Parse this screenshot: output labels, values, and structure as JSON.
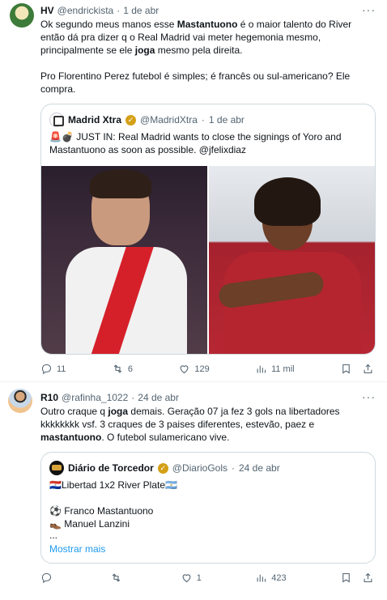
{
  "tweet1": {
    "name": "HV",
    "handle": "@endrickista",
    "date": "1 de abr",
    "text_p1_a": "Ok segundo meus manos esse ",
    "text_p1_b": "Mastantuono",
    "text_p1_c": " é o maior talento do River então dá pra dizer q o Real Madrid vai meter hegemonia mesmo, principalmente se ele ",
    "text_p1_d": "joga",
    "text_p1_e": " mesmo pela direita.",
    "text_p2": "Pro Florentino Perez futebol é simples; é francês ou sul-americano? Ele compra.",
    "quote": {
      "name": "Madrid Xtra",
      "handle": "@MadridXtra",
      "date": "1 de abr",
      "text": "🚨💣 JUST IN: Real Madrid wants to close the signings of Yoro and Mastantuono as soon as possible. @jfelixdiaz"
    },
    "stats": {
      "replies": "11",
      "retweets": "6",
      "likes": "129",
      "views": "11 mil"
    }
  },
  "tweet2": {
    "name": "R10",
    "handle": "@rafinha_1022",
    "date": "24 de abr",
    "text_a": "Outro craque q ",
    "text_b": "joga",
    "text_c": " demais. Geração 07 ja fez 3 gols na libertadores kkkkkkkk vsf. 3 craques de 3 paises diferentes, estevão, paez e ",
    "text_d": "mastantuono",
    "text_e": ". O futebol sulamericano vive.",
    "quote": {
      "name": "Diário de Torcedor",
      "handle": "@DiarioGols",
      "date": "24 de abr",
      "line1": "🇵🇾Libertad 1x2 River Plate🇦🇷",
      "line2": "⚽ Franco Mastantuono",
      "line3": "👞 Manuel Lanzini",
      "line4": "...",
      "show_more": "Mostrar mais"
    },
    "stats": {
      "replies": "",
      "retweets": "",
      "likes": "1",
      "views": "423"
    }
  },
  "icons": [
    "more-icon",
    "reply-icon",
    "retweet-icon",
    "like-icon",
    "views-icon",
    "bookmark-icon",
    "share-icon",
    "verified-badge-icon"
  ],
  "colors": {
    "link": "#1d9bf0",
    "muted": "#536471",
    "border": "#cfd9de",
    "verified_gold": "#d4a017"
  }
}
